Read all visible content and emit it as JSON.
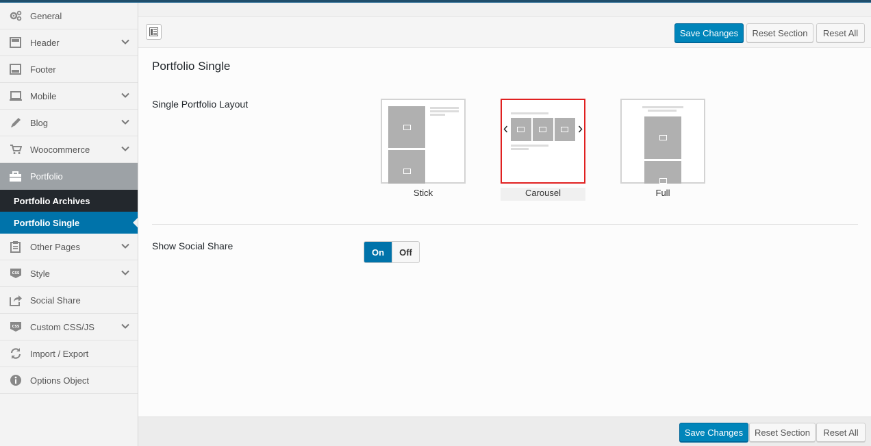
{
  "sidebar": {
    "items": [
      {
        "label": "General",
        "icon": "gears-icon",
        "expandable": false
      },
      {
        "label": "Header",
        "icon": "header-layout-icon",
        "expandable": true
      },
      {
        "label": "Footer",
        "icon": "footer-layout-icon",
        "expandable": false
      },
      {
        "label": "Mobile",
        "icon": "laptop-icon",
        "expandable": true
      },
      {
        "label": "Blog",
        "icon": "pencil-icon",
        "expandable": true
      },
      {
        "label": "Woocommerce",
        "icon": "cart-icon",
        "expandable": true
      },
      {
        "label": "Portfolio",
        "icon": "briefcase-icon",
        "expandable": false,
        "active": true
      }
    ],
    "sub_items": [
      {
        "label": "Portfolio Archives"
      },
      {
        "label": "Portfolio Single",
        "selected": true
      }
    ],
    "items_after": [
      {
        "label": "Other Pages",
        "icon": "clipboard-icon",
        "expandable": true
      },
      {
        "label": "Style",
        "icon": "css-icon",
        "expandable": true
      },
      {
        "label": "Social Share",
        "icon": "share-icon",
        "expandable": false
      },
      {
        "label": "Custom CSS/JS",
        "icon": "css-file-icon",
        "expandable": true
      },
      {
        "label": "Import / Export",
        "icon": "refresh-icon",
        "expandable": false
      },
      {
        "label": "Options Object",
        "icon": "info-icon",
        "expandable": false
      }
    ]
  },
  "toolbar": {
    "save_label": "Save Changes",
    "reset_section_label": "Reset Section",
    "reset_all_label": "Reset All"
  },
  "section": {
    "title": "Portfolio Single",
    "layout_label": "Single Portfolio Layout",
    "layout_options": [
      {
        "label": "Stick"
      },
      {
        "label": "Carousel",
        "selected": true
      },
      {
        "label": "Full"
      }
    ],
    "social_label": "Show Social Share",
    "toggle_on": "On",
    "toggle_off": "Off",
    "toggle_value": "On"
  },
  "colors": {
    "primary": "#0085ba",
    "active_sub": "#0073aa",
    "selected_border": "#e02020"
  }
}
